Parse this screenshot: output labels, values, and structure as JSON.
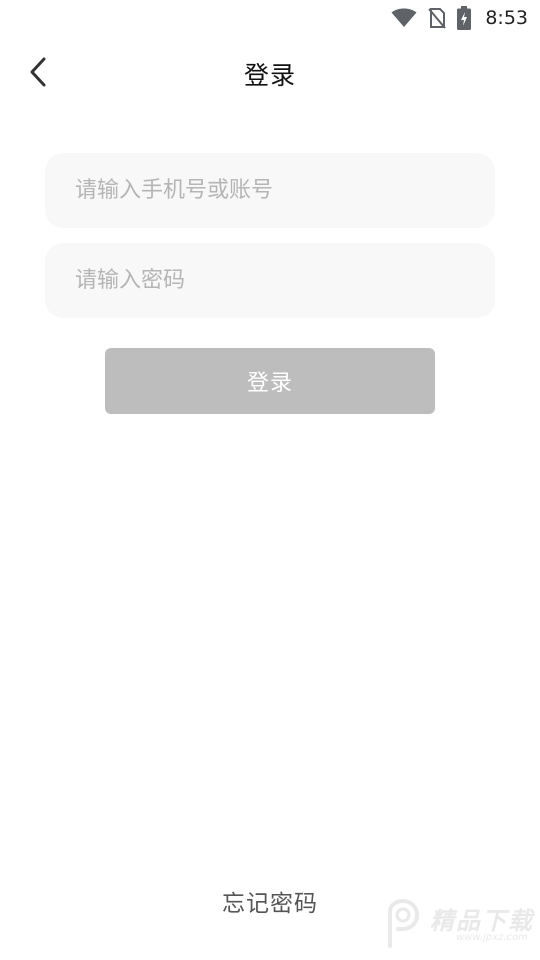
{
  "status_bar": {
    "time": "8:53",
    "icons": [
      "wifi-icon",
      "no-sim-icon",
      "battery-charging-icon"
    ]
  },
  "header": {
    "title": "登录",
    "back_icon": "chevron-left-icon"
  },
  "form": {
    "account_placeholder": "请输入手机号或账号",
    "account_value": "",
    "password_placeholder": "请输入密码",
    "password_value": "",
    "login_label": "登录"
  },
  "footer": {
    "forgot_password": "忘记密码"
  },
  "watermark": {
    "brand": "精品下载",
    "url": "www.jpxz.com"
  },
  "colors": {
    "button_disabled": "#bdbdbd",
    "field_bg": "#f8f8f8",
    "placeholder": "#b5b5b5"
  }
}
